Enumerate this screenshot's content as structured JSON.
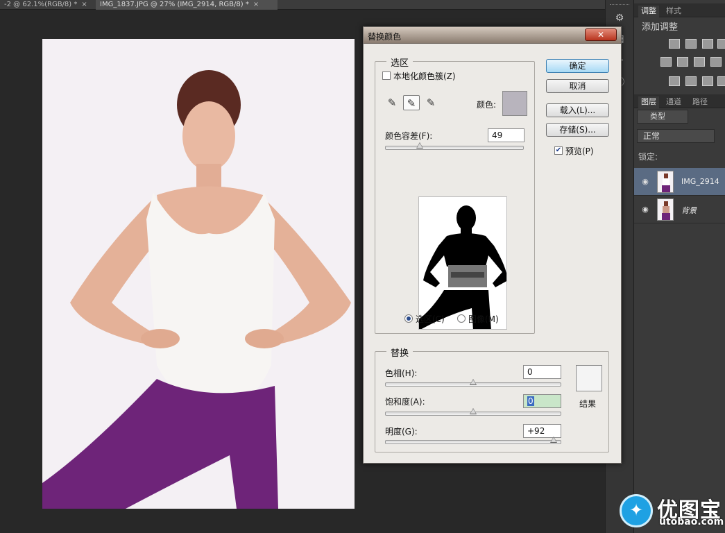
{
  "tabs": [
    {
      "label": "-2 @ 62.1%(RGB/8) *",
      "close": "×"
    },
    {
      "label": "IMG_1837.JPG @ 27% (IMG_2914, RGB/8) *",
      "close": "×"
    }
  ],
  "dialog": {
    "title": "替换颜色",
    "close": "✕",
    "selection": {
      "legend": "选区",
      "localized_label": "本地化颜色簇(Z)",
      "localized_checked": false,
      "color_label": "颜色:",
      "color_swatch": "#b8b4bd",
      "fuzziness_label": "颜色容差(F):",
      "fuzziness_value": "49",
      "fuzziness_fraction": 0.245,
      "radio_selection": "选区(C)",
      "radio_image": "图像(M)",
      "selected_radio": "selection"
    },
    "replacement": {
      "legend": "替换",
      "hue_label": "色相(H):",
      "hue_value": "0",
      "hue_fraction": 0.5,
      "saturation_label": "饱和度(A):",
      "saturation_value": "0",
      "saturation_fraction": 0.5,
      "lightness_label": "明度(G):",
      "lightness_value": "+92",
      "lightness_fraction": 0.96,
      "result_label": "结果",
      "result_swatch": "#f4f4f4"
    },
    "buttons": {
      "ok": "确定",
      "cancel": "取消",
      "load": "载入(L)...",
      "save": "存储(S)...",
      "preview": "预览(P)",
      "preview_checked": true
    }
  },
  "panels": {
    "adjust_tabs": [
      "调整",
      "样式"
    ],
    "adjust_title": "添加调整",
    "layer_tabs": [
      "图层",
      "通道",
      "路径"
    ],
    "kind_filter": "类型",
    "blend_mode": "正常",
    "lock_label": "锁定:",
    "layers": [
      {
        "name": "IMG_2914",
        "selected": true,
        "italic": false
      },
      {
        "name": "背景",
        "selected": false,
        "italic": true
      }
    ]
  },
  "watermark": {
    "brand": "优图宝",
    "url": "utobao.com"
  }
}
